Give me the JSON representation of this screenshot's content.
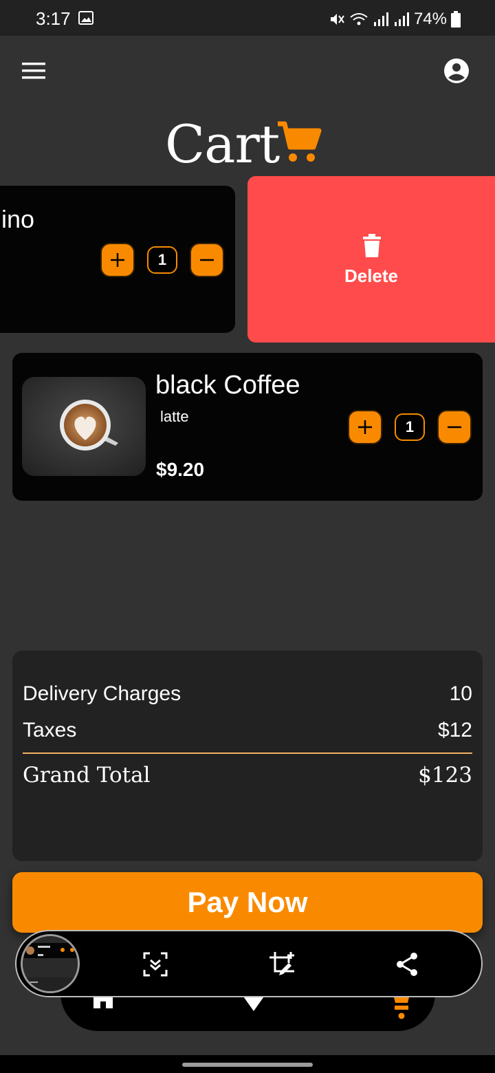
{
  "status_bar": {
    "time": "3:17",
    "battery": "74%"
  },
  "header": {
    "title": "Cart"
  },
  "swiped_item": {
    "name": "ino",
    "quantity": "1",
    "delete_label": "Delete"
  },
  "items": [
    {
      "name": "black Coffee",
      "variant": "latte",
      "price": "$9.20",
      "quantity": "1"
    }
  ],
  "summary": {
    "delivery_label": "Delivery Charges",
    "delivery_value": "10",
    "taxes_label": "Taxes",
    "taxes_value": "$12",
    "total_label": "Grand Total",
    "total_value": "$123"
  },
  "pay_button": "Pay Now",
  "colors": {
    "accent": "#f98a00",
    "delete": "#ff4b4b",
    "background": "#323232",
    "card": "#040404"
  },
  "icons": [
    "menu-icon",
    "profile-icon",
    "cart-icon",
    "plus-icon",
    "minus-icon",
    "trash-icon",
    "home-icon",
    "heart-icon",
    "scroll-capture-icon",
    "crop-edit-icon",
    "share-icon"
  ]
}
